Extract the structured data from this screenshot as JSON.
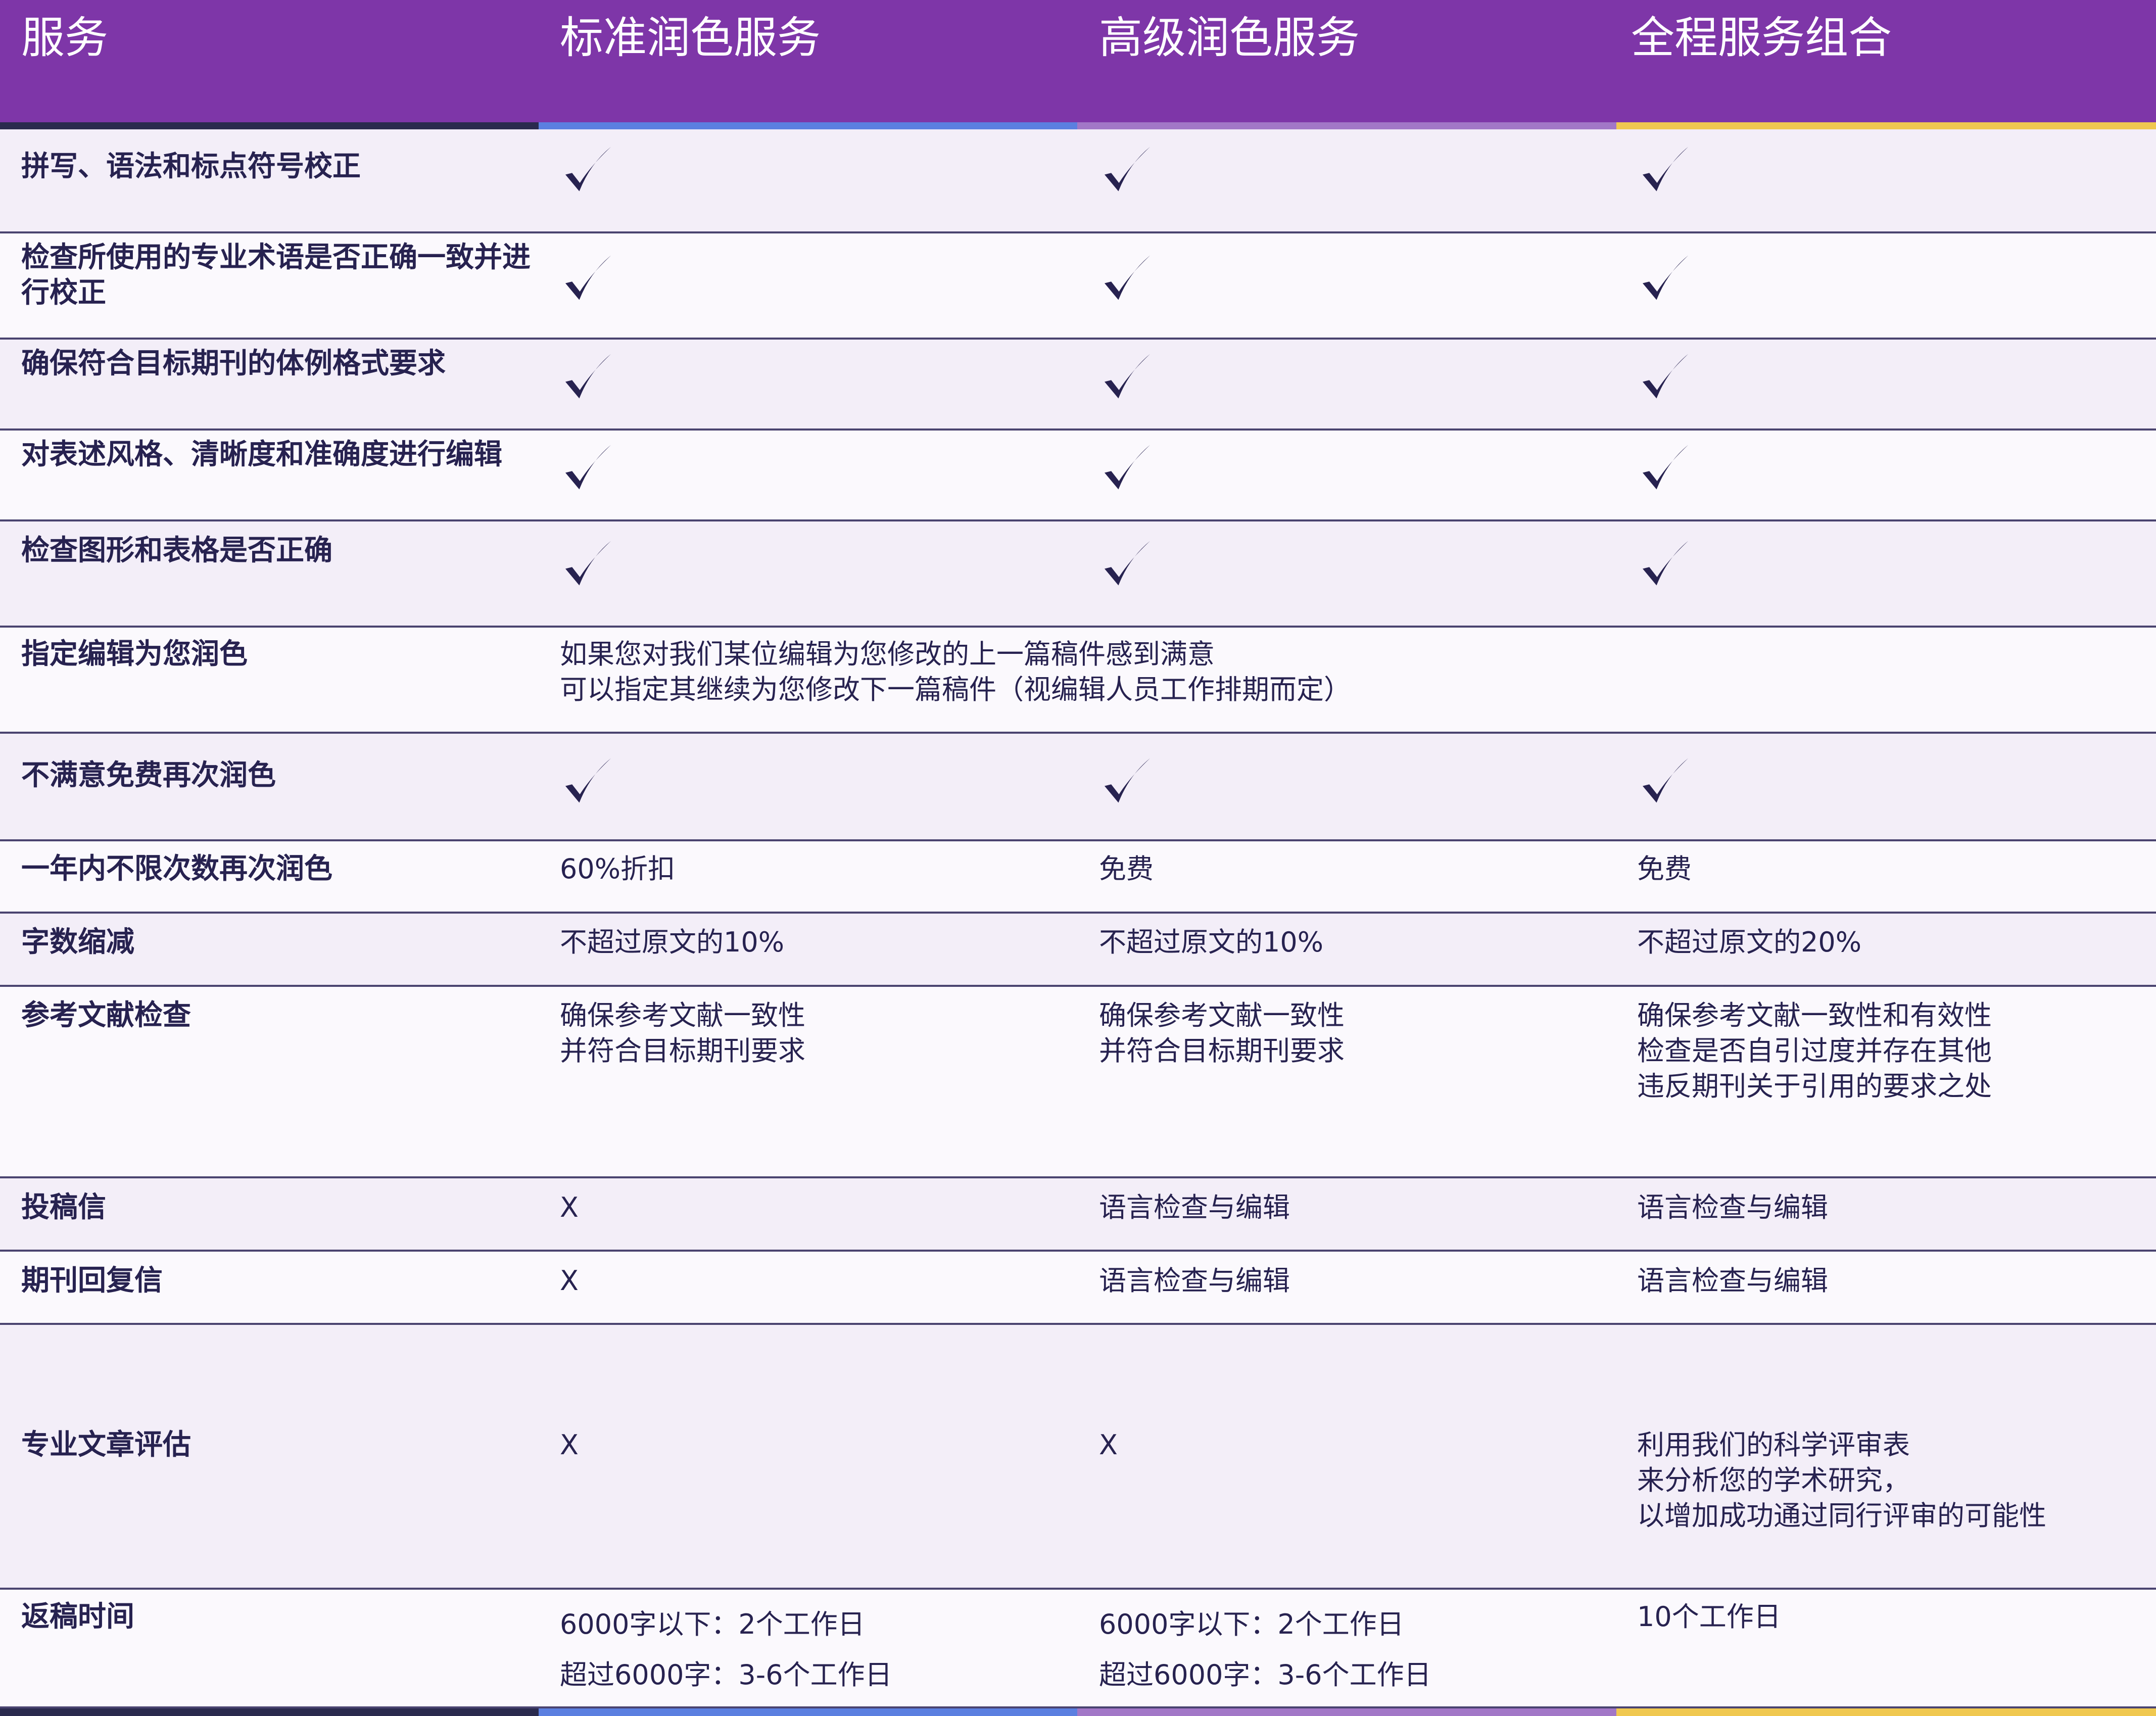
{
  "header": {
    "col0": "服务",
    "col1": "标准润色服务",
    "col2": "高级润色服务",
    "col3": "全程服务组合"
  },
  "colors": {
    "header_bg": "#7e36a8",
    "bar_col0": "#2a2a4e",
    "bar_col1": "#5b7fe0",
    "bar_col2": "#a277c7",
    "bar_col3": "#f0c850",
    "text": "#272250"
  },
  "rows": [
    {
      "feature": "拼写、语法和标点符号校正",
      "cells": [
        "check",
        "check",
        "check"
      ]
    },
    {
      "feature": "检查所使用的专业术语是否正确一致并进行校正",
      "cells": [
        "check",
        "check",
        "check"
      ]
    },
    {
      "feature": "确保符合目标期刊的体例格式要求",
      "cells": [
        "check",
        "check",
        "check"
      ]
    },
    {
      "feature": "对表述风格、清晰度和准确度进行编辑",
      "cells": [
        "check",
        "check",
        "check"
      ]
    },
    {
      "feature": "检查图形和表格是否正确",
      "cells": [
        "check",
        "check",
        "check"
      ]
    },
    {
      "feature": "指定编辑为您润色",
      "span_text": [
        "如果您对我们某位编辑为您修改的上一篇稿件感到满意",
        "可以指定其继续为您修改下一篇稿件（视编辑人员工作排期而定）"
      ]
    },
    {
      "feature": "不满意免费再次润色",
      "cells": [
        "check",
        "check",
        "check"
      ]
    },
    {
      "feature": "一年内不限次数再次润色",
      "cells": [
        "60%折扣",
        "免费",
        "免费"
      ]
    },
    {
      "feature": "字数缩减",
      "cells": [
        "不超过原文的10%",
        "不超过原文的10%",
        "不超过原文的20%"
      ]
    },
    {
      "feature": "参考文献检查",
      "cells": [
        [
          "确保参考文献一致性",
          "并符合目标期刊要求"
        ],
        [
          "确保参考文献一致性",
          "并符合目标期刊要求"
        ],
        [
          "确保参考文献一致性和有效性",
          "检查是否自引过度并存在其他",
          "违反期刊关于引用的要求之处"
        ]
      ]
    },
    {
      "feature": "投稿信",
      "cells": [
        "X",
        "语言检查与编辑",
        "语言检查与编辑"
      ]
    },
    {
      "feature": "期刊回复信",
      "cells": [
        "X",
        "语言检查与编辑",
        "语言检查与编辑"
      ]
    },
    {
      "feature": "专业文章评估",
      "cells": [
        "X",
        "X",
        [
          "利用我们的科学评审表",
          "来分析您的学术研究，",
          "以增加成功通过同行评审的可能性"
        ]
      ]
    },
    {
      "feature": "返稿时间",
      "cells": [
        [
          "6000字以下：2个工作日",
          "超过6000字：3-6个工作日"
        ],
        [
          "6000字以下：2个工作日",
          "超过6000字：3-6个工作日"
        ],
        "10个工作日"
      ]
    }
  ]
}
